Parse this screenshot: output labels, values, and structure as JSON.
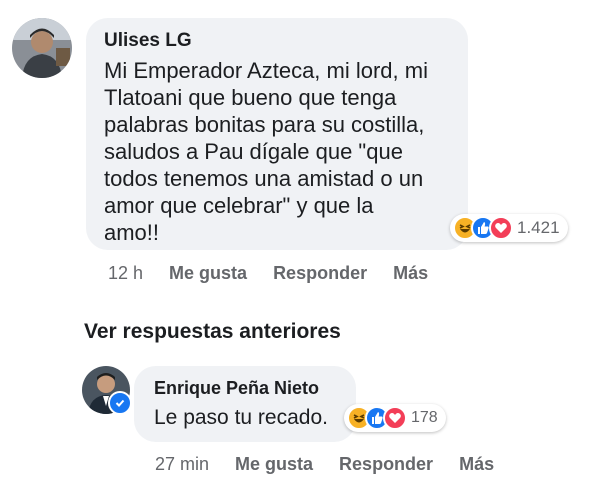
{
  "comment1": {
    "author": "Ulises LG",
    "text_lines": [
      "Mi Emperador Azteca, mi lord, mi",
      "Tlatoani que bueno que tenga",
      "palabras bonitas para su costilla,",
      "saludos a Pau dígale que \"que",
      "todos tenemos una amistad o un",
      "amor que celebrar\" y que la",
      "amo!!"
    ],
    "reactions": [
      "haha-icon",
      "like-icon",
      "love-icon"
    ],
    "reaction_count": "1.421",
    "time": "12 h",
    "like_label": "Me gusta",
    "reply_label": "Responder",
    "more_label": "Más"
  },
  "see_previous": "Ver respuestas anteriores",
  "reply1": {
    "author": "Enrique Peña Nieto",
    "text": "Le paso tu recado.",
    "reactions": [
      "haha-icon",
      "like-icon",
      "love-icon"
    ],
    "reaction_count": "178",
    "time": "27 min",
    "like_label": "Me gusta",
    "reply_label": "Responder",
    "more_label": "Más"
  },
  "colors": {
    "bubble": "#f0f2f5",
    "secondary_text": "#65676b",
    "like_blue": "#1877f2",
    "love_red": "#f33e58",
    "haha_yellow": "#f7b125"
  }
}
